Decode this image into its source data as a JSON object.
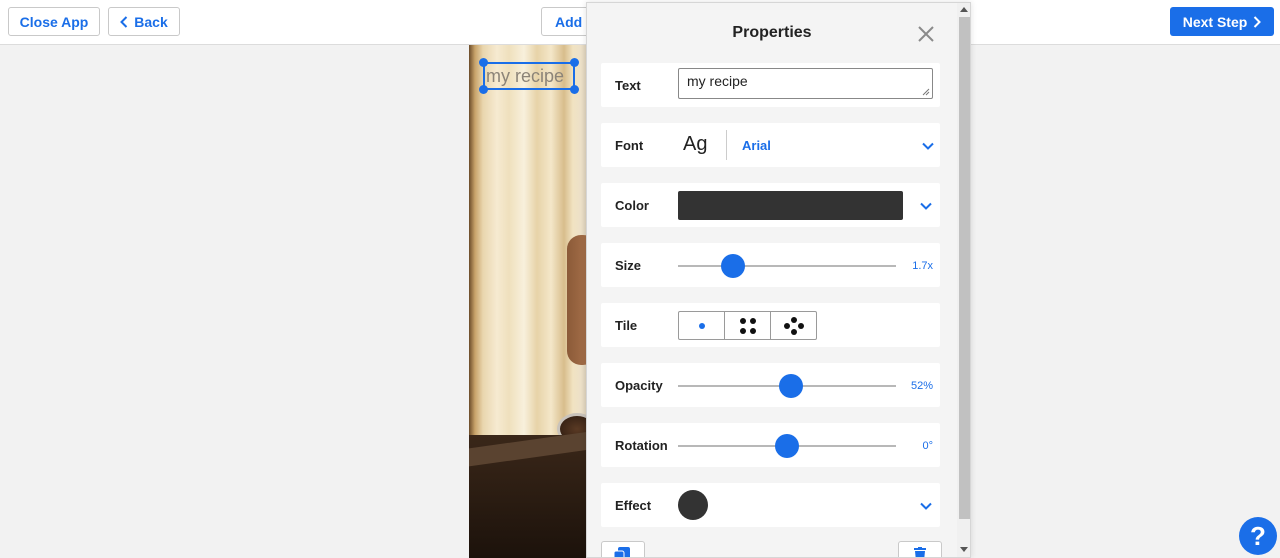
{
  "toolbar": {
    "close_label": "Close App",
    "back_label": "Back",
    "add_label": "Add",
    "next_label": "Next Step"
  },
  "canvas": {
    "selected_text": "my recipe"
  },
  "panel": {
    "title": "Properties",
    "text": {
      "label": "Text",
      "value": "my recipe"
    },
    "font": {
      "label": "Font",
      "preview": "Ag",
      "value": "Arial"
    },
    "color": {
      "label": "Color",
      "value": "#333333"
    },
    "size": {
      "label": "Size",
      "value": "1.7x",
      "fraction": 0.25
    },
    "tile": {
      "label": "Tile",
      "options": [
        "single-dot-icon",
        "four-dots-icon",
        "five-dots-icon"
      ],
      "selected": 0
    },
    "opacity": {
      "label": "Opacity",
      "value": "52%",
      "fraction": 0.52
    },
    "rotation": {
      "label": "Rotation",
      "value": "0°",
      "fraction": 0.5
    },
    "effect": {
      "label": "Effect",
      "value": "#333333"
    }
  },
  "help": {
    "label": "?"
  },
  "colors": {
    "accent": "#1a6ee8"
  }
}
